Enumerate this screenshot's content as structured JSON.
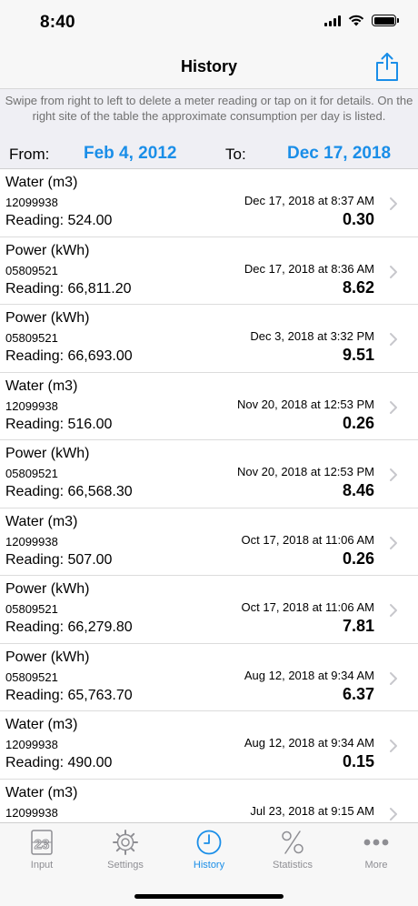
{
  "status_bar": {
    "time": "8:40"
  },
  "nav": {
    "title": "History",
    "share_icon": "share-icon"
  },
  "info": {
    "text": "Swipe from right to left to delete a meter reading or tap on it for details. On the right site of the table the approximate consumption per day is listed.",
    "from_label": "From:",
    "from_value": "Feb 4, 2012",
    "to_label": "To:",
    "to_value": "Dec 17, 2018"
  },
  "readings": [
    {
      "name": "Water (m3)",
      "serial": "12099938",
      "reading": "Reading: 524.00",
      "date": "Dec 17, 2018 at 8:37 AM",
      "consumption": "0.30"
    },
    {
      "name": "Power (kWh)",
      "serial": "05809521",
      "reading": "Reading: 66,811.20",
      "date": "Dec 17, 2018 at 8:36 AM",
      "consumption": "8.62"
    },
    {
      "name": "Power (kWh)",
      "serial": "05809521",
      "reading": "Reading: 66,693.00",
      "date": "Dec 3, 2018 at 3:32 PM",
      "consumption": "9.51"
    },
    {
      "name": "Water (m3)",
      "serial": "12099938",
      "reading": "Reading: 516.00",
      "date": "Nov 20, 2018 at 12:53 PM",
      "consumption": "0.26"
    },
    {
      "name": "Power (kWh)",
      "serial": "05809521",
      "reading": "Reading: 66,568.30",
      "date": "Nov 20, 2018 at 12:53 PM",
      "consumption": "8.46"
    },
    {
      "name": "Water (m3)",
      "serial": "12099938",
      "reading": "Reading: 507.00",
      "date": "Oct 17, 2018 at 11:06 AM",
      "consumption": "0.26"
    },
    {
      "name": "Power (kWh)",
      "serial": "05809521",
      "reading": "Reading: 66,279.80",
      "date": "Oct 17, 2018 at 11:06 AM",
      "consumption": "7.81"
    },
    {
      "name": "Power (kWh)",
      "serial": "05809521",
      "reading": "Reading: 65,763.70",
      "date": "Aug 12, 2018 at 9:34 AM",
      "consumption": "6.37"
    },
    {
      "name": "Water (m3)",
      "serial": "12099938",
      "reading": "Reading: 490.00",
      "date": "Aug 12, 2018 at 9:34 AM",
      "consumption": "0.15"
    },
    {
      "name": "Water (m3)",
      "serial": "12099938",
      "reading": "",
      "date": "Jul 23, 2018 at 9:15 AM",
      "consumption": ""
    }
  ],
  "tabs": [
    {
      "label": "Input",
      "icon": "calendar-23-icon",
      "active": false
    },
    {
      "label": "Settings",
      "icon": "gear-icon",
      "active": false
    },
    {
      "label": "History",
      "icon": "clock-icon",
      "active": true
    },
    {
      "label": "Statistics",
      "icon": "percent-icon",
      "active": false
    },
    {
      "label": "More",
      "icon": "more-dots-icon",
      "active": false
    }
  ],
  "colors": {
    "accent": "#1a8ee8",
    "inactive": "#8e8e93",
    "chevron": "#c7c7cc",
    "info_background": "#efeff4"
  },
  "input_icon_text": "23"
}
